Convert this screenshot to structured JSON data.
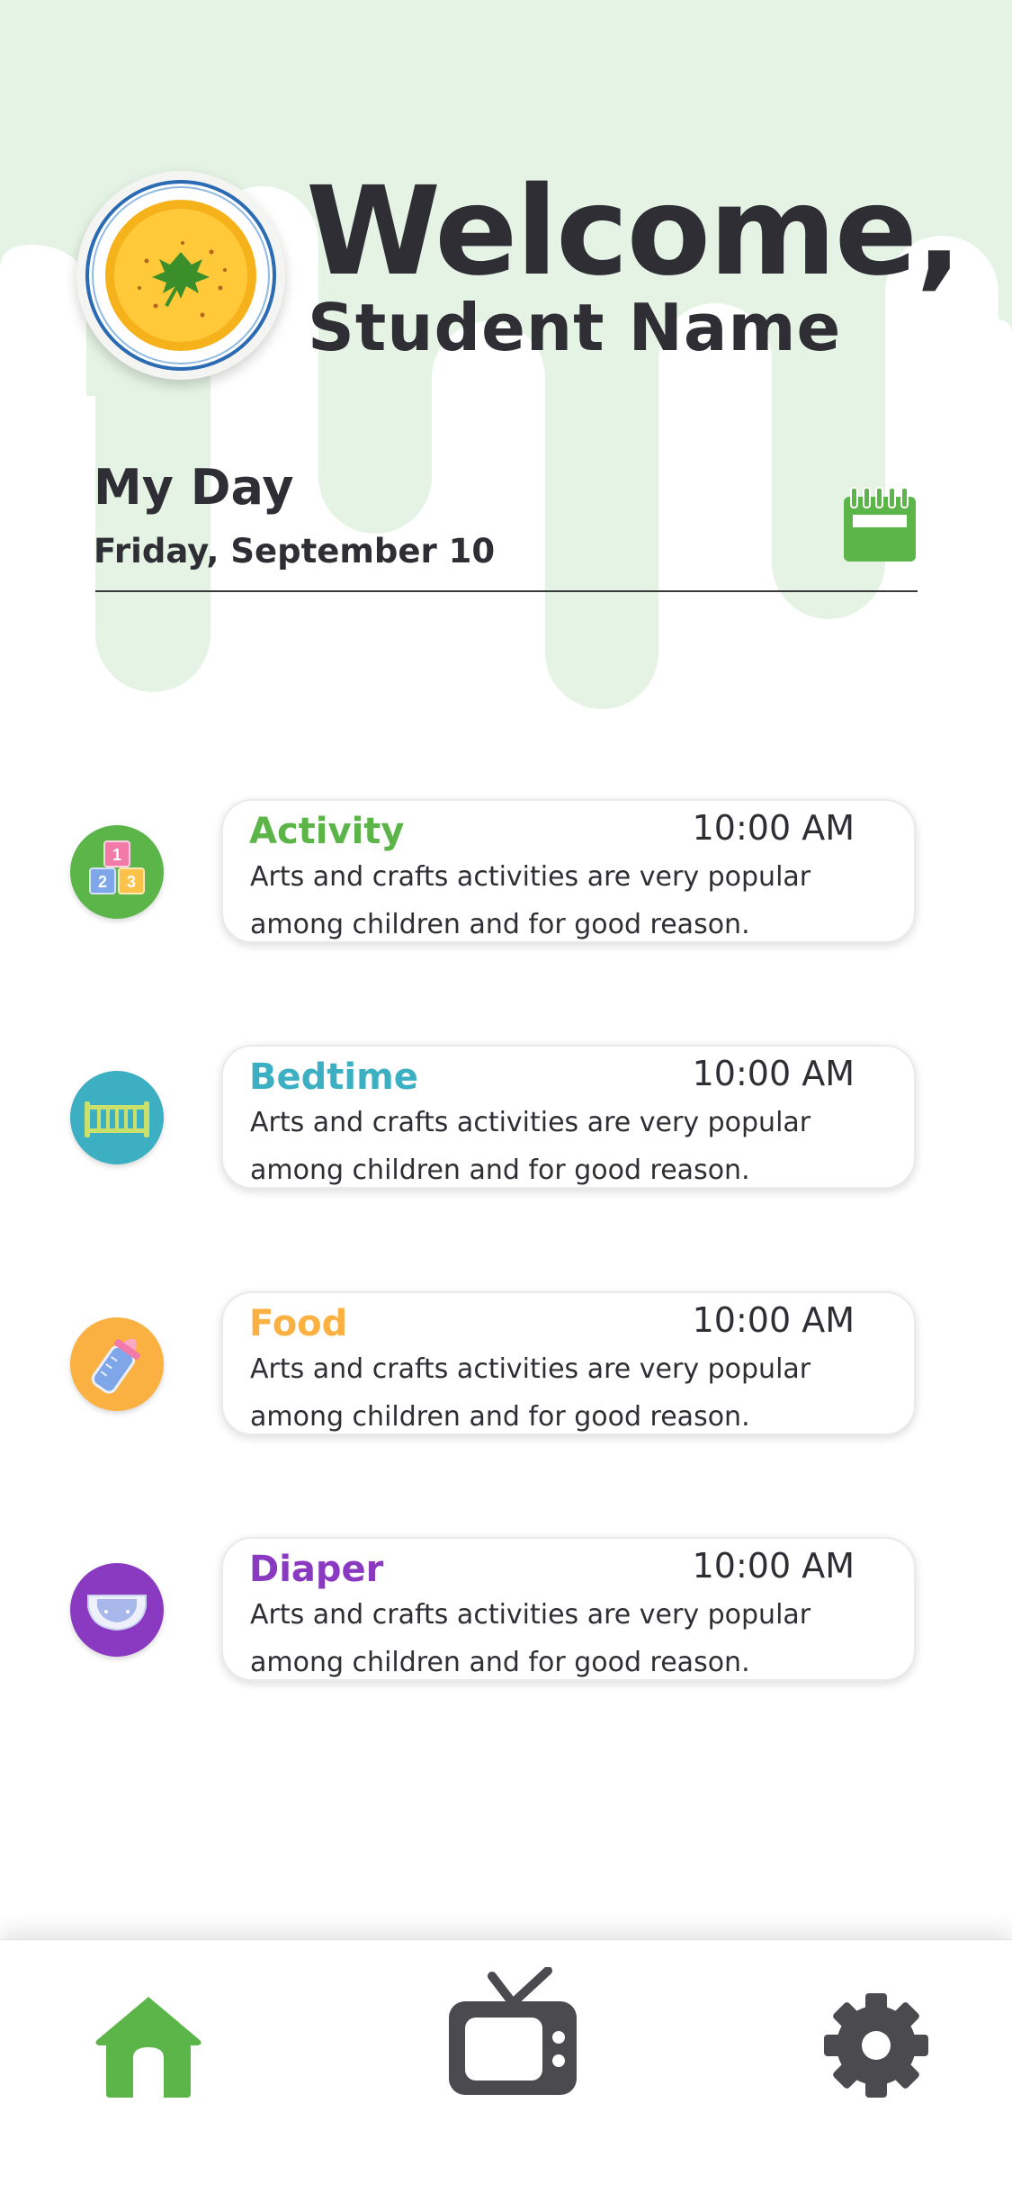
{
  "colors": {
    "accent_green": "#5cb548",
    "background_green": "#e4f3e4",
    "bedtime_teal": "#3cafc2",
    "food_orange": "#fbb042",
    "diaper_purple": "#8a3ac1",
    "text_dark": "#2f2e35",
    "icon_grey": "#4a4a4f"
  },
  "header": {
    "welcome": "Welcome,",
    "student_name": "Student Name",
    "avatar_icon": "soup-bowl-icon"
  },
  "myday": {
    "title": "My Day",
    "date": "Friday, September 10",
    "calendar_icon": "calendar-icon"
  },
  "entries": [
    {
      "title": "Activity",
      "time": "10:00 AM",
      "line1": "Arts and crafts activities are very popular",
      "line2": "among children and for good reason.",
      "icon": "toy-blocks-icon",
      "color": "#5cb548"
    },
    {
      "title": "Bedtime",
      "time": "10:00 AM",
      "line1": "Arts and crafts activities are very popular",
      "line2": "among children and for good reason.",
      "icon": "crib-icon",
      "color": "#3cafc2"
    },
    {
      "title": "Food",
      "time": "10:00 AM",
      "line1": "Arts and crafts activities are very popular",
      "line2": "among children and for good reason.",
      "icon": "baby-bottle-icon",
      "color": "#fbb042"
    },
    {
      "title": "Diaper",
      "time": "10:00 AM",
      "line1": "Arts and crafts activities are very popular",
      "line2": "among children and for good reason.",
      "icon": "diaper-icon",
      "color": "#8a3ac1"
    }
  ],
  "tabbar": {
    "tabs": [
      {
        "name": "home",
        "icon": "home-icon",
        "active": true
      },
      {
        "name": "tv",
        "icon": "tv-icon",
        "active": false
      },
      {
        "name": "settings",
        "icon": "gear-icon",
        "active": false
      }
    ]
  }
}
